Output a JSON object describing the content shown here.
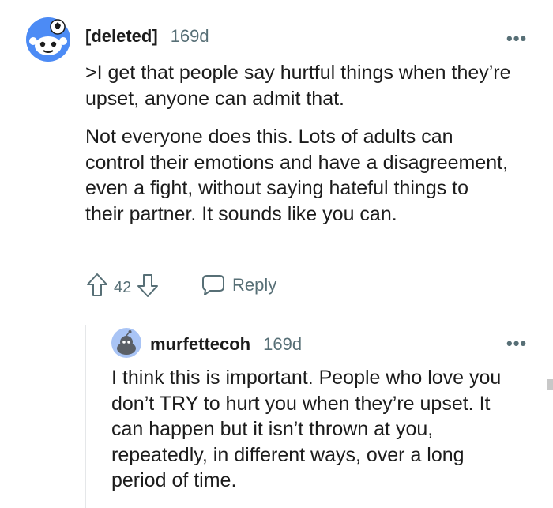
{
  "comment": {
    "author": "[deleted]",
    "age": "169d",
    "more_label": "•••",
    "paragraphs": [
      ">I get that people say hurtful things when they’re upset, anyone can admit that.",
      "Not everyone does this. Lots of adults can control their emotions and have a disagreement, even a fight, without saying hateful things to their partner. It sounds like you can."
    ],
    "vote_count": "42",
    "reply_label": "Reply"
  },
  "reply": {
    "author": "murfettecoh",
    "age": "169d",
    "more_label": "•••",
    "paragraphs": [
      "I think this is important. People who love you don’t TRY to hurt you when they’re upset. It can happen but it isn’t thrown at you, repeatedly, in different ways, over a long period of time."
    ]
  },
  "colors": {
    "avatar_bg": "#4c8bf5",
    "reply_avatar_bg": "#a9c4f5",
    "meta": "#576f76",
    "thread_line": "#e5e7e9"
  }
}
